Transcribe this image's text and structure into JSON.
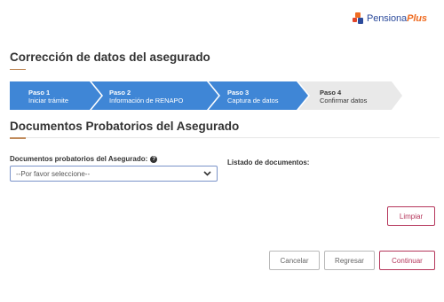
{
  "brand": {
    "name_part1": "Pensiona",
    "name_part2": "Plus"
  },
  "page": {
    "title": "Corrección de datos del asegurado"
  },
  "stepper": {
    "steps": [
      {
        "number": "Paso 1",
        "label": "Iniciar trámite",
        "state": "completed"
      },
      {
        "number": "Paso 2",
        "label": "Información de RENAPO",
        "state": "completed"
      },
      {
        "number": "Paso 3",
        "label": "Captura de datos",
        "state": "completed"
      },
      {
        "number": "Paso 4",
        "label": "Confirmar datos",
        "state": "current"
      }
    ],
    "colors": {
      "active": "#3f86d6",
      "inactive": "#e9e9e9"
    }
  },
  "section": {
    "title": "Documentos Probatorios del Asegurado"
  },
  "documents": {
    "select_label": "Documentos probatorios del Asegurado:",
    "help_icon": "question-circle-icon",
    "select_value": "--Por favor seleccione--",
    "list_label": "Listado de documentos:"
  },
  "actions": {
    "clear_label": "Limpiar",
    "cancel_label": "Cancelar",
    "back_label": "Regresar",
    "continue_label": "Continuar",
    "accent_color": "#b5365b"
  }
}
